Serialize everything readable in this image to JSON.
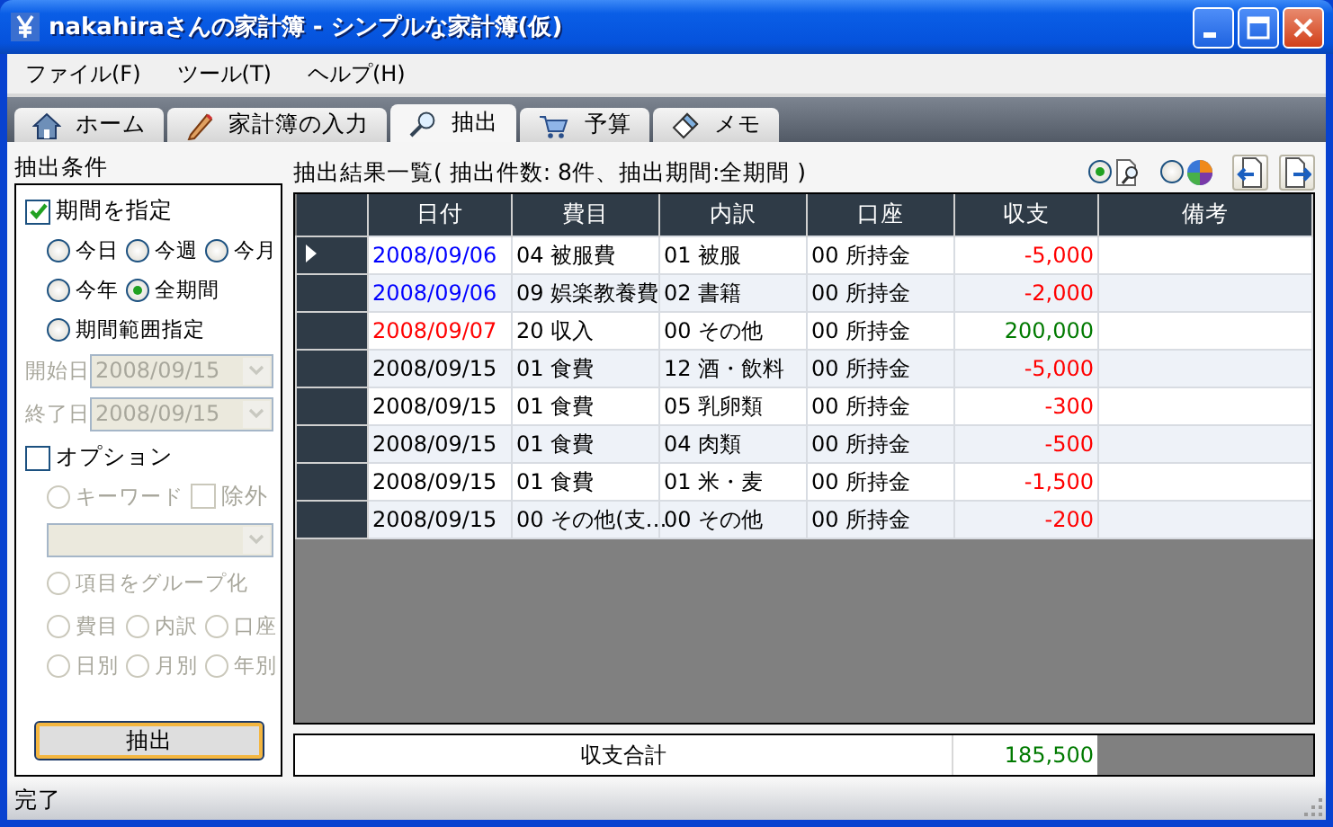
{
  "window": {
    "title": "nakahiraさんの家計簿 - シンプルな家計簿(仮)"
  },
  "menu": [
    {
      "label": "ファイル(F)"
    },
    {
      "label": "ツール(T)"
    },
    {
      "label": "ヘルプ(H)"
    }
  ],
  "tabs": [
    {
      "label": "ホーム",
      "selected": false
    },
    {
      "label": "家計簿の入力",
      "selected": false
    },
    {
      "label": "抽出",
      "selected": true
    },
    {
      "label": "予算",
      "selected": false
    },
    {
      "label": "メモ",
      "selected": false
    }
  ],
  "conditions": {
    "title": "抽出条件",
    "period_checkbox": {
      "label": "期間を指定",
      "checked": true
    },
    "period_options": [
      [
        {
          "label": "今日",
          "selected": false
        },
        {
          "label": "今週",
          "selected": false
        },
        {
          "label": "今月",
          "selected": false
        }
      ],
      [
        {
          "label": "今年",
          "selected": false
        },
        {
          "label": "全期間",
          "selected": true
        }
      ],
      [
        {
          "label": "期間範囲指定",
          "selected": false
        }
      ]
    ],
    "dates": [
      {
        "label": "開始日",
        "value": "2008/09/15",
        "disabled": true
      },
      {
        "label": "終了日",
        "value": "2008/09/15",
        "disabled": true
      }
    ],
    "option_checkbox": {
      "label": "オプション",
      "checked": false
    },
    "keyword": {
      "label": "キーワード",
      "selected": false,
      "disabled": true
    },
    "exclude": {
      "label": "除外",
      "checked": false,
      "disabled": true
    },
    "keyword_field": {
      "disabled": true
    },
    "group": {
      "label": "項目をグループ化",
      "selected": false,
      "disabled": true
    },
    "group_options": [
      [
        {
          "label": "費目",
          "selected": false,
          "disabled": true
        },
        {
          "label": "内訳",
          "selected": false,
          "disabled": true
        },
        {
          "label": "口座",
          "selected": false,
          "disabled": true
        }
      ],
      [
        {
          "label": "日別",
          "selected": false,
          "disabled": true
        },
        {
          "label": "月別",
          "selected": false,
          "disabled": true
        },
        {
          "label": "年別",
          "selected": false,
          "disabled": true
        }
      ]
    ],
    "button": "抽出"
  },
  "results": {
    "title": "抽出結果一覧( 抽出件数: 8件、抽出期間:全期間 )",
    "view_options": [
      {
        "selected": true
      },
      {
        "selected": false
      }
    ],
    "columns": [
      "日付",
      "費目",
      "内訳",
      "口座",
      "収支",
      "備考"
    ],
    "rows": [
      {
        "selected": true,
        "date": "2008/09/06",
        "color": "#0000ff",
        "category": "04 被服費",
        "detail": "01 被服",
        "account": "00 所持金",
        "amount": "-5,000",
        "kind": "expense"
      },
      {
        "selected": false,
        "date": "2008/09/06",
        "color": "#0000ff",
        "category": "09 娯楽教養費",
        "detail": "02 書籍",
        "account": "00 所持金",
        "amount": "-2,000",
        "kind": "expense"
      },
      {
        "selected": false,
        "date": "2008/09/07",
        "color": "#ff0000",
        "category": "20 収入",
        "detail": "00 その他",
        "account": "00 所持金",
        "amount": "200,000",
        "kind": "income"
      },
      {
        "selected": false,
        "date": "2008/09/15",
        "color": "#000000",
        "category": "01 食費",
        "detail": "12 酒・飲料",
        "account": "00 所持金",
        "amount": "-5,000",
        "kind": "expense"
      },
      {
        "selected": false,
        "date": "2008/09/15",
        "color": "#000000",
        "category": "01 食費",
        "detail": "05 乳卵類",
        "account": "00 所持金",
        "amount": "-300",
        "kind": "expense"
      },
      {
        "selected": false,
        "date": "2008/09/15",
        "color": "#000000",
        "category": "01 食費",
        "detail": "04 肉類",
        "account": "00 所持金",
        "amount": "-500",
        "kind": "expense"
      },
      {
        "selected": false,
        "date": "2008/09/15",
        "color": "#000000",
        "category": "01 食費",
        "detail": "01 米・麦",
        "account": "00 所持金",
        "amount": "-1,500",
        "kind": "expense"
      },
      {
        "selected": false,
        "date": "2008/09/15",
        "color": "#000000",
        "category": "00 その他(支…",
        "detail": "00 その他",
        "account": "00 所持金",
        "amount": "-200",
        "kind": "expense"
      }
    ],
    "total": {
      "label": "収支合計",
      "value": "185,500",
      "kind": "income"
    }
  },
  "status_bar": "完了"
}
